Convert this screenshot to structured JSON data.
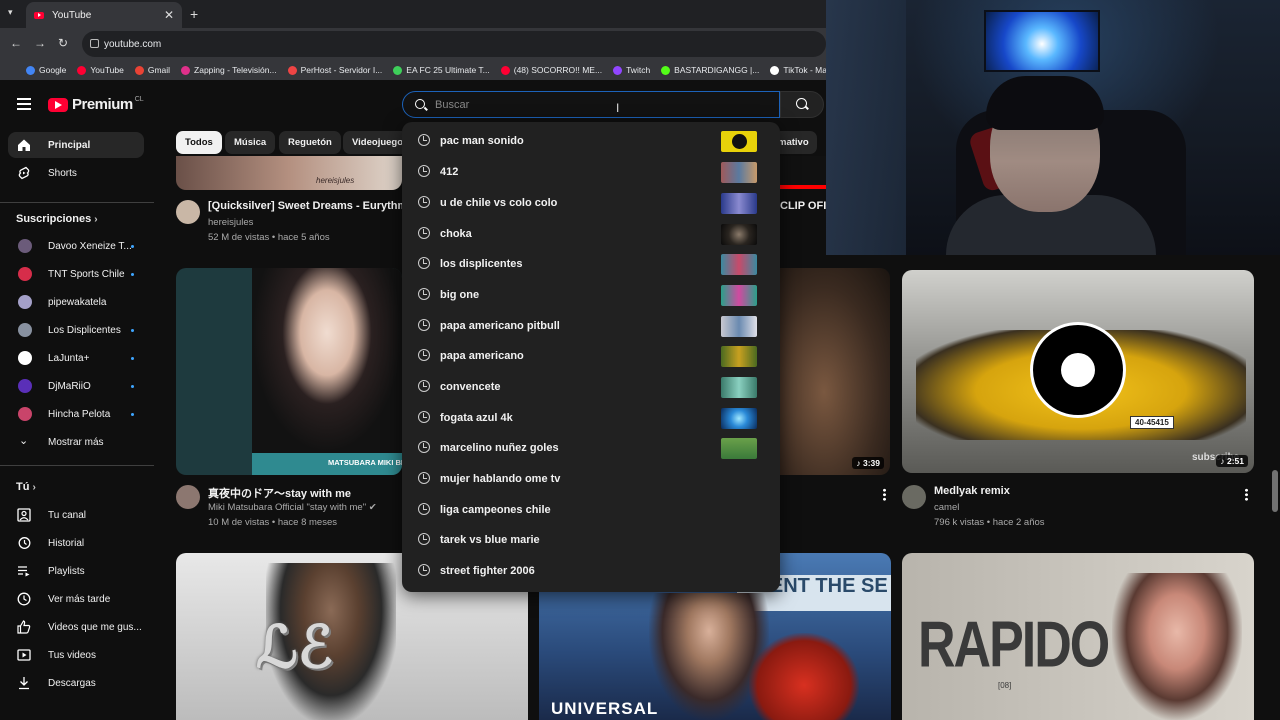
{
  "browser": {
    "tab_title": "YouTube",
    "url": "youtube.com",
    "bookmarks": [
      {
        "label": "Google",
        "color": "#4285f4"
      },
      {
        "label": "YouTube",
        "color": "#ff0033"
      },
      {
        "label": "Gmail",
        "color": "#ea4335"
      },
      {
        "label": "Zapping - Televisión...",
        "color": "#e0308a"
      },
      {
        "label": "PerHost - Servidor I...",
        "color": "#ee4444"
      },
      {
        "label": "EA FC 25 Ultimate T...",
        "color": "#3ecf5a"
      },
      {
        "label": "(48) SOCORRO!! ME...",
        "color": "#ff0033"
      },
      {
        "label": "Twitch",
        "color": "#9146ff"
      },
      {
        "label": "BASTARDIGANGG |...",
        "color": "#53fc18"
      },
      {
        "label": "TikTok - Make Yo...",
        "color": "#ffffff"
      }
    ]
  },
  "header": {
    "logo_text": "Premium",
    "country_code": "CL",
    "search_placeholder": "Buscar"
  },
  "sidebar": {
    "main": [
      {
        "label": "Principal",
        "icon": "home-icon"
      },
      {
        "label": "Shorts",
        "icon": "shorts-icon"
      }
    ],
    "subscriptions_title": "Suscripciones",
    "subscriptions": [
      {
        "label": "Davoo Xeneize T...",
        "color": "#6b5b7a"
      },
      {
        "label": "TNT Sports Chile",
        "color": "#d62d4a"
      },
      {
        "label": "pipewakatela",
        "color": "#a4a0c8"
      },
      {
        "label": "Los Displicentes",
        "color": "#8891a0"
      },
      {
        "label": "LaJunta+",
        "color": "#ffffff"
      },
      {
        "label": "DjMaRiiO",
        "color": "#5a2fb8"
      },
      {
        "label": "Hincha Pelota",
        "color": "#c9446a"
      }
    ],
    "show_more": "Mostrar más",
    "you_title": "Tú",
    "you_items": [
      {
        "label": "Tu canal",
        "icon": "channel-icon"
      },
      {
        "label": "Historial",
        "icon": "history-icon"
      },
      {
        "label": "Playlists",
        "icon": "playlist-icon"
      },
      {
        "label": "Ver más tarde",
        "icon": "watch-later-icon"
      },
      {
        "label": "Videos que me gus...",
        "icon": "like-icon"
      },
      {
        "label": "Tus videos",
        "icon": "your-videos-icon"
      },
      {
        "label": "Descargas",
        "icon": "download-icon"
      }
    ]
  },
  "chips": [
    "Todos",
    "Música",
    "Reguetón",
    "Videojuegos",
    "mativo"
  ],
  "videos": [
    {
      "title": "[Quicksilver] Sweet Dreams - Eurythmics",
      "channel": "hereisjules",
      "stats": "52 M de vistas • hace 5 años",
      "thumb_text": "hereisjules"
    },
    {
      "title": "真夜中のドア〜stay with me",
      "channel": "Miki Matsubara Official \"stay with me\"",
      "stats": "10 M de vistas • hace 8 meses",
      "thumb_text": "MATSUBARA MIKI BES"
    },
    {
      "title": "Medlyak remix",
      "channel": "camel",
      "stats": "796 k vistas • hace 2 años",
      "duration": "2:51",
      "thumb_text": "subscribe"
    },
    {
      "title": "CLIP OFIC",
      "duration": "3:39"
    },
    {
      "title": "",
      "thumb_text": "RAPIDO",
      "thumb_sub": "[08]"
    },
    {
      "title": "",
      "thumb_text": "UNIVERSAL",
      "thumb_sub": "TMENT THE SE"
    }
  ],
  "suggestions": [
    {
      "text": "pac man sonido",
      "color": "#e8d20a"
    },
    {
      "text": "412",
      "color": "#7a3a4a"
    },
    {
      "text": "u de chile vs colo colo",
      "color": "#3a4a8a"
    },
    {
      "text": "choka",
      "color": "#2a2520"
    },
    {
      "text": "los displicentes",
      "color": "#3a8aa0"
    },
    {
      "text": "big one",
      "color": "#2aa08a"
    },
    {
      "text": "papa americano pitbull",
      "color": "#c8c8d0"
    },
    {
      "text": "papa americano",
      "color": "#4a6a20"
    },
    {
      "text": "convencete",
      "color": "#3a7a6a"
    },
    {
      "text": "fogata azul 4k",
      "color": "#2a8ad8"
    },
    {
      "text": "marcelino nuñez goles",
      "color": "#3a7a3a"
    },
    {
      "text": "mujer hablando ome tv",
      "color": ""
    },
    {
      "text": "liga campeones chile",
      "color": ""
    },
    {
      "text": "tarek vs blue marie",
      "color": ""
    },
    {
      "text": "street fighter 2006",
      "color": ""
    }
  ],
  "plate_text": "40-45415"
}
